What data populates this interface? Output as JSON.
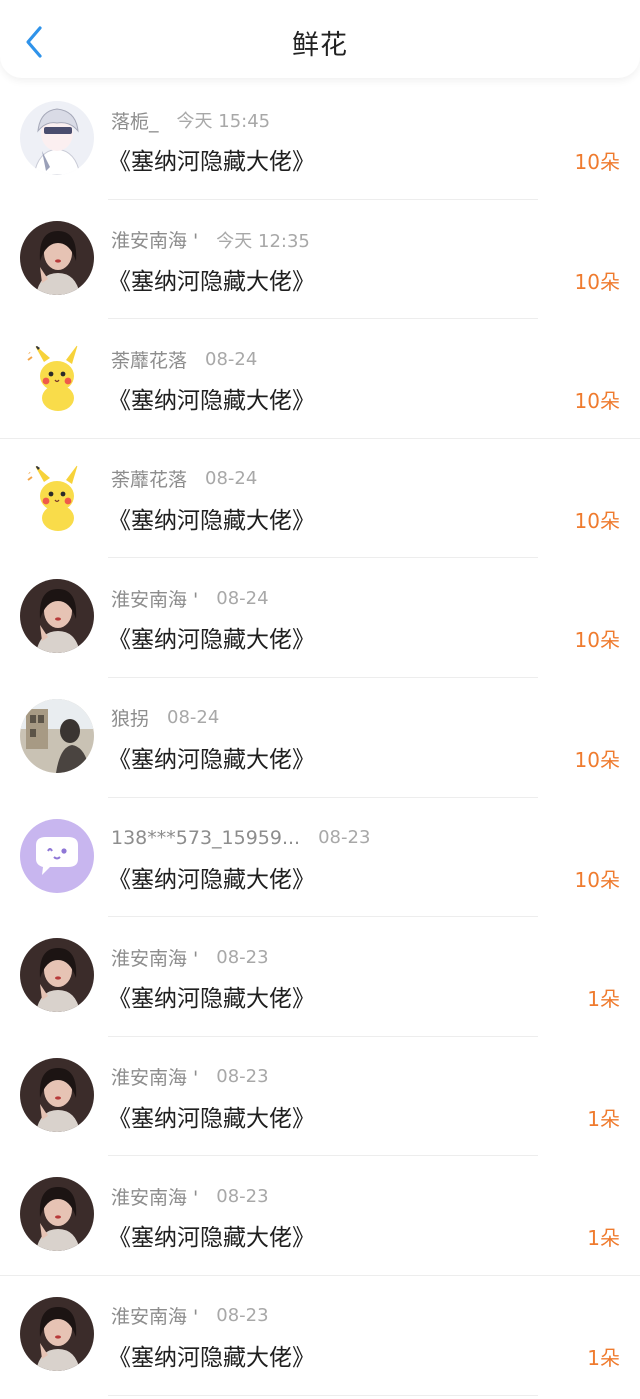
{
  "header": {
    "title": "鲜花",
    "back_icon": "chevron-left-icon",
    "accent_color": "#2f93ea"
  },
  "colors": {
    "count": "#ef7b2e",
    "name": "#8d8d8d",
    "time": "#a8a8a8"
  },
  "items": [
    {
      "avatar": "anime-boy-avatar",
      "name": "落栀_",
      "time": "今天 15:45",
      "book": "《塞纳河隐藏大佬》",
      "count": "10朵"
    },
    {
      "avatar": "girl-photo-avatar",
      "name": "淮安南海 '",
      "time": "今天 12:35",
      "book": "《塞纳河隐藏大佬》",
      "count": "10朵"
    },
    {
      "avatar": "pikachu-avatar",
      "name": "荼蘼花落",
      "time": "08-24",
      "book": "《塞纳河隐藏大佬》",
      "count": "10朵"
    },
    {
      "avatar": "pikachu-avatar",
      "name": "荼蘼花落",
      "time": "08-24",
      "book": "《塞纳河隐藏大佬》",
      "count": "10朵"
    },
    {
      "avatar": "girl-photo-avatar",
      "name": "淮安南海 '",
      "time": "08-24",
      "book": "《塞纳河隐藏大佬》",
      "count": "10朵"
    },
    {
      "avatar": "street-photo-avatar",
      "name": "狼拐",
      "time": "08-24",
      "book": "《塞纳河隐藏大佬》",
      "count": "10朵"
    },
    {
      "avatar": "chat-bubble-avatar",
      "name": "138***573_15959...",
      "time": "08-23",
      "book": "《塞纳河隐藏大佬》",
      "count": "10朵"
    },
    {
      "avatar": "girl-photo-avatar",
      "name": "淮安南海 '",
      "time": "08-23",
      "book": "《塞纳河隐藏大佬》",
      "count": "1朵"
    },
    {
      "avatar": "girl-photo-avatar",
      "name": "淮安南海 '",
      "time": "08-23",
      "book": "《塞纳河隐藏大佬》",
      "count": "1朵"
    },
    {
      "avatar": "girl-photo-avatar",
      "name": "淮安南海 '",
      "time": "08-23",
      "book": "《塞纳河隐藏大佬》",
      "count": "1朵"
    },
    {
      "avatar": "girl-photo-avatar",
      "name": "淮安南海 '",
      "time": "08-23",
      "book": "《塞纳河隐藏大佬》",
      "count": "1朵"
    }
  ]
}
